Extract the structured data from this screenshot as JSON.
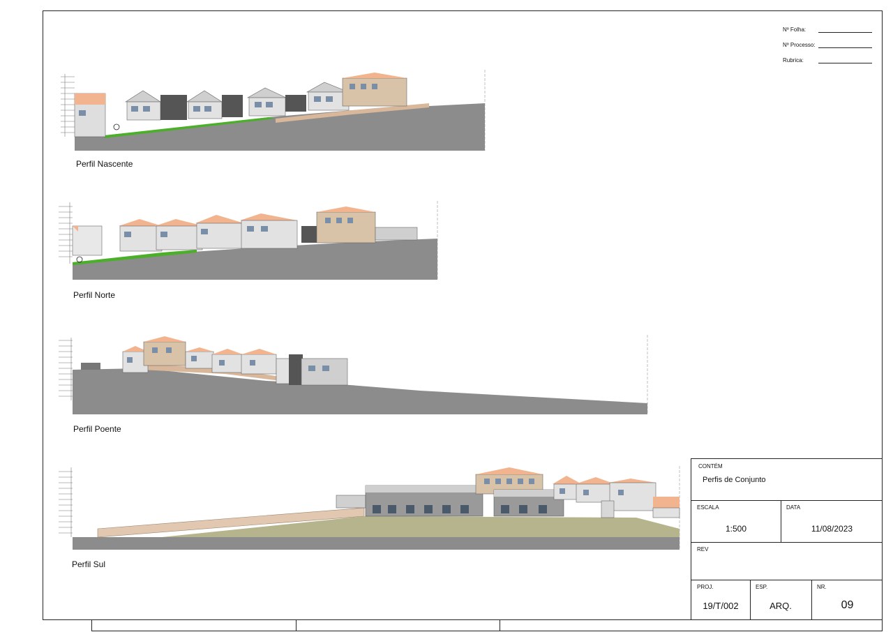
{
  "signatures": {
    "folha": "Nº Folha:",
    "processo": "Nº Processo:",
    "rubrica": "Rubrica:"
  },
  "profiles": [
    {
      "label": "Perfil Nascente"
    },
    {
      "label": "Perfil Norte"
    },
    {
      "label": "Perfil Poente"
    },
    {
      "label": "Perfil Sul"
    }
  ],
  "title_block": {
    "contem_label": "CONTÉM",
    "contem_value": "Perfis de Conjunto",
    "escala_label": "ESCALA",
    "escala_value": "1:500",
    "data_label": "DATA",
    "data_value": "11/08/2023",
    "rev_label": "REV",
    "proj_label": "PROJ.",
    "proj_value": "19/T/002",
    "esp_label": "ESP.",
    "esp_value": "ARQ.",
    "nr_label": "NR.",
    "nr_value": "09"
  },
  "colors": {
    "ground": "#8a8a8a",
    "grass": "#4caf2a",
    "roof": "#f2b48e",
    "wall_light": "#dcdcdc",
    "wall_dark": "#5a5a5a",
    "tan_wall": "#d9b79a",
    "stone": "#d8c2a8"
  }
}
